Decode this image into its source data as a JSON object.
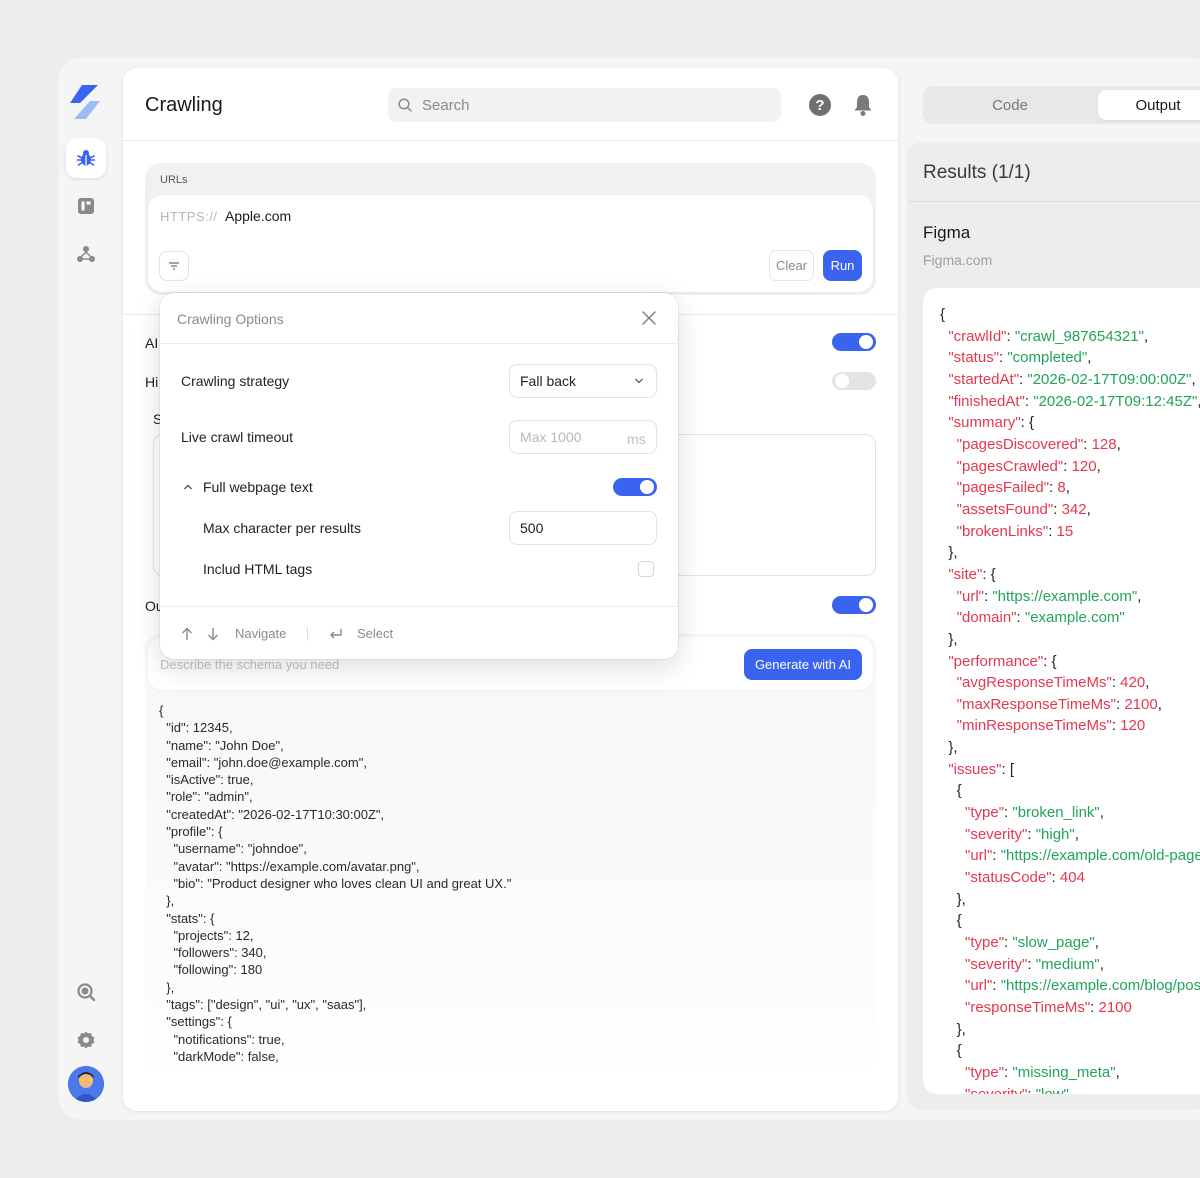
{
  "header": {
    "title": "Crawling",
    "search_placeholder": "Search"
  },
  "url_card": {
    "label": "URLs",
    "prefix": "HTTPS://",
    "value": "Apple.com",
    "clear_label": "Clear",
    "run_label": "Run"
  },
  "rows": {
    "ai_partial": "AI",
    "hi_partial": "Hi",
    "s_partial": "S",
    "ou_partial": "Ou"
  },
  "toggles": {
    "ai": true,
    "hi": false,
    "ou": true
  },
  "schema": {
    "placeholder": "Describe the schema you need",
    "generate_label": "Generate with AI",
    "code": "{\n  \"id\": 12345,\n  \"name\": \"John Doe\",\n  \"email\": \"john.doe@example.com\",\n  \"isActive\": true,\n  \"role\": \"admin\",\n  \"createdAt\": \"2026-02-17T10:30:00Z\",\n  \"profile\": {\n    \"username\": \"johndoe\",\n    \"avatar\": \"https://example.com/avatar.png\",\n    \"bio\": \"Product designer who loves clean UI and great UX.\"\n  },\n  \"stats\": {\n    \"projects\": 12,\n    \"followers\": 340,\n    \"following\": 180\n  },\n  \"tags\": [\"design\", \"ui\", \"ux\", \"saas\"],\n  \"settings\": {\n    \"notifications\": true,\n    \"darkMode\": false,"
  },
  "popover": {
    "title": "Crawling Options",
    "strategy_label": "Crawling strategy",
    "strategy_value": "Fall back",
    "timeout_label": "Live crawl timeout",
    "timeout_placeholder": "Max 1000",
    "timeout_unit": "ms",
    "fulltext_label": "Full webpage text",
    "fulltext_enabled": true,
    "maxchar_label": "Max character per results",
    "maxchar_value": "500",
    "html_tags_label": "Includ HTML tags",
    "html_tags_checked": false,
    "hint_navigate": "Navigate",
    "hint_select": "Select"
  },
  "right": {
    "tab_code": "Code",
    "tab_output": "Output",
    "results_title": "Results (1/1)",
    "site_name": "Figma",
    "site_url": "Figma.com",
    "json_lines": [
      [
        [
          "p",
          "{"
        ]
      ],
      [
        [
          "i",
          "  "
        ],
        [
          "k",
          "\"crawlId\""
        ],
        [
          "p",
          ": "
        ],
        [
          "s",
          "\"crawl_987654321\""
        ],
        [
          "p",
          ","
        ]
      ],
      [
        [
          "i",
          "  "
        ],
        [
          "k",
          "\"status\""
        ],
        [
          "p",
          ": "
        ],
        [
          "s",
          "\"completed\""
        ],
        [
          "p",
          ","
        ]
      ],
      [
        [
          "i",
          "  "
        ],
        [
          "k",
          "\"startedAt\""
        ],
        [
          "p",
          ": "
        ],
        [
          "s",
          "\"2026-02-17T09:00:00Z\""
        ],
        [
          "p",
          ","
        ]
      ],
      [
        [
          "i",
          "  "
        ],
        [
          "k",
          "\"finishedAt\""
        ],
        [
          "p",
          ": "
        ],
        [
          "s",
          "\"2026-02-17T09:12:45Z\""
        ],
        [
          "p",
          ","
        ]
      ],
      [
        [
          "i",
          "  "
        ],
        [
          "k",
          "\"summary\""
        ],
        [
          "p",
          ": {"
        ]
      ],
      [
        [
          "i",
          "    "
        ],
        [
          "k",
          "\"pagesDiscovered\""
        ],
        [
          "p",
          ": "
        ],
        [
          "n",
          "128"
        ],
        [
          "p",
          ","
        ]
      ],
      [
        [
          "i",
          "    "
        ],
        [
          "k",
          "\"pagesCrawled\""
        ],
        [
          "p",
          ": "
        ],
        [
          "n",
          "120"
        ],
        [
          "p",
          ","
        ]
      ],
      [
        [
          "i",
          "    "
        ],
        [
          "k",
          "\"pagesFailed\""
        ],
        [
          "p",
          ": "
        ],
        [
          "n",
          "8"
        ],
        [
          "p",
          ","
        ]
      ],
      [
        [
          "i",
          "    "
        ],
        [
          "k",
          "\"assetsFound\""
        ],
        [
          "p",
          ": "
        ],
        [
          "n",
          "342"
        ],
        [
          "p",
          ","
        ]
      ],
      [
        [
          "i",
          "    "
        ],
        [
          "k",
          "\"brokenLinks\""
        ],
        [
          "p",
          ": "
        ],
        [
          "n",
          "15"
        ]
      ],
      [
        [
          "i",
          "  "
        ],
        [
          "p",
          "},"
        ]
      ],
      [
        [
          "i",
          "  "
        ],
        [
          "k",
          "\"site\""
        ],
        [
          "p",
          ": {"
        ]
      ],
      [
        [
          "i",
          "    "
        ],
        [
          "k",
          "\"url\""
        ],
        [
          "p",
          ": "
        ],
        [
          "s",
          "\"https://example.com\""
        ],
        [
          "p",
          ","
        ]
      ],
      [
        [
          "i",
          "    "
        ],
        [
          "k",
          "\"domain\""
        ],
        [
          "p",
          ": "
        ],
        [
          "s",
          "\"example.com\""
        ]
      ],
      [
        [
          "i",
          "  "
        ],
        [
          "p",
          "},"
        ]
      ],
      [
        [
          "i",
          "  "
        ],
        [
          "k",
          "\"performance\""
        ],
        [
          "p",
          ": {"
        ]
      ],
      [
        [
          "i",
          "    "
        ],
        [
          "k",
          "\"avgResponseTimeMs\""
        ],
        [
          "p",
          ": "
        ],
        [
          "n",
          "420"
        ],
        [
          "p",
          ","
        ]
      ],
      [
        [
          "i",
          "    "
        ],
        [
          "k",
          "\"maxResponseTimeMs\""
        ],
        [
          "p",
          ": "
        ],
        [
          "n",
          "2100"
        ],
        [
          "p",
          ","
        ]
      ],
      [
        [
          "i",
          "    "
        ],
        [
          "k",
          "\"minResponseTimeMs\""
        ],
        [
          "p",
          ": "
        ],
        [
          "n",
          "120"
        ]
      ],
      [
        [
          "i",
          "  "
        ],
        [
          "p",
          "},"
        ]
      ],
      [
        [
          "i",
          "  "
        ],
        [
          "k",
          "\"issues\""
        ],
        [
          "p",
          ": ["
        ]
      ],
      [
        [
          "i",
          "    "
        ],
        [
          "p",
          "{"
        ]
      ],
      [
        [
          "i",
          "      "
        ],
        [
          "k",
          "\"type\""
        ],
        [
          "p",
          ": "
        ],
        [
          "s",
          "\"broken_link\""
        ],
        [
          "p",
          ","
        ]
      ],
      [
        [
          "i",
          "      "
        ],
        [
          "k",
          "\"severity\""
        ],
        [
          "p",
          ": "
        ],
        [
          "s",
          "\"high\""
        ],
        [
          "p",
          ","
        ]
      ],
      [
        [
          "i",
          "      "
        ],
        [
          "k",
          "\"url\""
        ],
        [
          "p",
          ": "
        ],
        [
          "s",
          "\"https://example.com/old-page\""
        ],
        [
          "p",
          ","
        ]
      ],
      [
        [
          "i",
          "      "
        ],
        [
          "k",
          "\"statusCode\""
        ],
        [
          "p",
          ": "
        ],
        [
          "n",
          "404"
        ]
      ],
      [
        [
          "i",
          "    "
        ],
        [
          "p",
          "},"
        ]
      ],
      [
        [
          "i",
          "    "
        ],
        [
          "p",
          "{"
        ]
      ],
      [
        [
          "i",
          "      "
        ],
        [
          "k",
          "\"type\""
        ],
        [
          "p",
          ": "
        ],
        [
          "s",
          "\"slow_page\""
        ],
        [
          "p",
          ","
        ]
      ],
      [
        [
          "i",
          "      "
        ],
        [
          "k",
          "\"severity\""
        ],
        [
          "p",
          ": "
        ],
        [
          "s",
          "\"medium\""
        ],
        [
          "p",
          ","
        ]
      ],
      [
        [
          "i",
          "      "
        ],
        [
          "k",
          "\"url\""
        ],
        [
          "p",
          ": "
        ],
        [
          "s",
          "\"https://example.com/blog/post\""
        ],
        [
          "p",
          ","
        ]
      ],
      [
        [
          "i",
          "      "
        ],
        [
          "k",
          "\"responseTimeMs\""
        ],
        [
          "p",
          ": "
        ],
        [
          "n",
          "2100"
        ]
      ],
      [
        [
          "i",
          "    "
        ],
        [
          "p",
          "},"
        ]
      ],
      [
        [
          "i",
          "    "
        ],
        [
          "p",
          "{"
        ]
      ],
      [
        [
          "i",
          "      "
        ],
        [
          "k",
          "\"type\""
        ],
        [
          "p",
          ": "
        ],
        [
          "s",
          "\"missing_meta\""
        ],
        [
          "p",
          ","
        ]
      ],
      [
        [
          "i",
          "      "
        ],
        [
          "k",
          "\"severity\""
        ],
        [
          "p",
          ": "
        ],
        [
          "s",
          "\"low\""
        ],
        [
          "p",
          ","
        ]
      ]
    ]
  },
  "colors": {
    "accent": "#3a63f0",
    "json_key": "#e5384f",
    "json_string": "#22a35a"
  },
  "icons": [
    "logo-icon",
    "bug-icon",
    "dashboard-icon",
    "nodes-icon",
    "search-icon",
    "settings-icon",
    "help-icon",
    "bell-icon",
    "filter-icon",
    "close-icon",
    "chevron-down-icon",
    "chevron-up-icon",
    "arrow-up-icon",
    "arrow-down-icon",
    "enter-icon"
  ]
}
